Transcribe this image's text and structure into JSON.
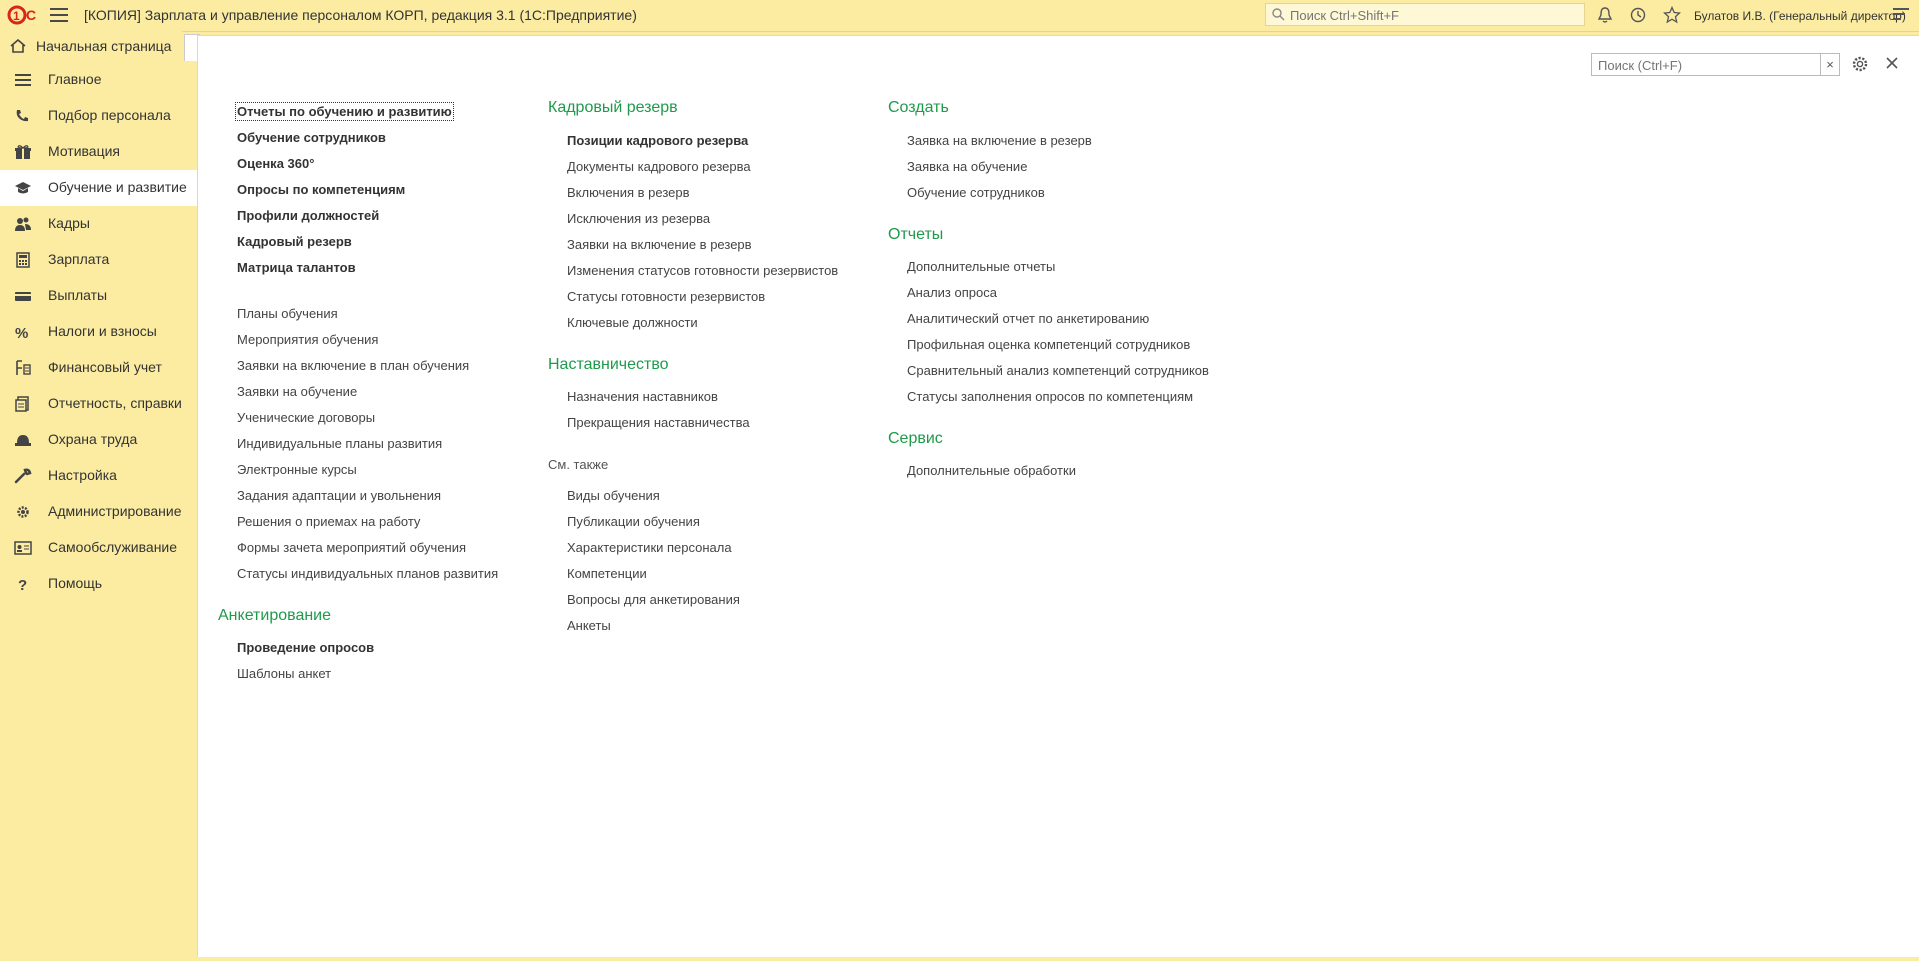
{
  "window": {
    "title": "[КОПИЯ] Зарплата и управление персоналом КОРП, редакция 3.1  (1С:Предприятие)",
    "search_placeholder": "Поиск Ctrl+Shift+F",
    "user": "Булатов И.В. (Генеральный директор)"
  },
  "tabs": {
    "home": "Начальная страница"
  },
  "sidebar": {
    "items": [
      {
        "label": "Главное",
        "icon": "list-icon"
      },
      {
        "label": "Подбор персонала",
        "icon": "phone-icon"
      },
      {
        "label": "Мотивация",
        "icon": "gift-icon"
      },
      {
        "label": "Обучение и развитие",
        "icon": "graduation-cap-icon",
        "active": true
      },
      {
        "label": "Кадры",
        "icon": "people-icon"
      },
      {
        "label": "Зарплата",
        "icon": "calculator-icon"
      },
      {
        "label": "Выплаты",
        "icon": "wallet-icon"
      },
      {
        "label": "Налоги и взносы",
        "icon": "percent-icon"
      },
      {
        "label": "Финансовый учет",
        "icon": "ledger-icon"
      },
      {
        "label": "Отчетность, справки",
        "icon": "report-icon"
      },
      {
        "label": "Охрана труда",
        "icon": "helmet-icon"
      },
      {
        "label": "Настройка",
        "icon": "wrench-icon"
      },
      {
        "label": "Администрирование",
        "icon": "gear-icon"
      },
      {
        "label": "Самообслуживание",
        "icon": "id-card-icon"
      },
      {
        "label": "Помощь",
        "icon": "question-icon"
      }
    ]
  },
  "panel": {
    "search_placeholder": "Поиск (Ctrl+F)",
    "clear": "×",
    "col1": {
      "bold_links": [
        "Отчеты по обучению и развитию",
        "Обучение сотрудников",
        "Оценка 360°",
        "Опросы по компетенциям",
        "Профили должностей",
        "Кадровый резерв",
        "Матрица талантов"
      ],
      "links": [
        "Планы обучения",
        "Мероприятия обучения",
        "Заявки на включение в план обучения",
        "Заявки на обучение",
        "Ученические договоры",
        "Индивидуальные планы развития",
        "Электронные курсы",
        "Задания адаптации и увольнения",
        "Решения о приемах на работу",
        "Формы зачета мероприятий обучения",
        "Статусы индивидуальных планов развития"
      ],
      "survey_head": "Анкетирование",
      "survey_bold": "Проведение опросов",
      "survey_link": "Шаблоны анкет"
    },
    "col2": {
      "reserve_head": "Кадровый резерв",
      "reserve_bold": "Позиции кадрового резерва",
      "reserve_links": [
        "Документы кадрового резерва",
        "Включения в резерв",
        "Исключения из резерва",
        "Заявки на включение в резерв",
        "Изменения статусов готовности резервистов",
        "Статусы готовности резервистов",
        "Ключевые должности"
      ],
      "mentor_head": "Наставничество",
      "mentor_links": [
        "Назначения наставников",
        "Прекращения наставничества"
      ],
      "see_also": "См. также",
      "see_links": [
        "Виды обучения",
        "Публикации обучения",
        "Характеристики персонала",
        "Компетенции",
        "Вопросы для анкетирования",
        "Анкеты"
      ]
    },
    "col3": {
      "create_head": "Создать",
      "create_links": [
        "Заявка на включение в резерв",
        "Заявка на обучение",
        "Обучение сотрудников"
      ],
      "reports_head": "Отчеты",
      "reports_links": [
        "Дополнительные отчеты",
        "Анализ опроса",
        "Аналитический отчет по анкетированию",
        "Профильная оценка компетенций сотрудников",
        "Сравнительный анализ компетенций сотрудников",
        "Статусы заполнения опросов по компетенциям"
      ],
      "service_head": "Сервис",
      "service_links": [
        "Дополнительные обработки"
      ]
    }
  }
}
